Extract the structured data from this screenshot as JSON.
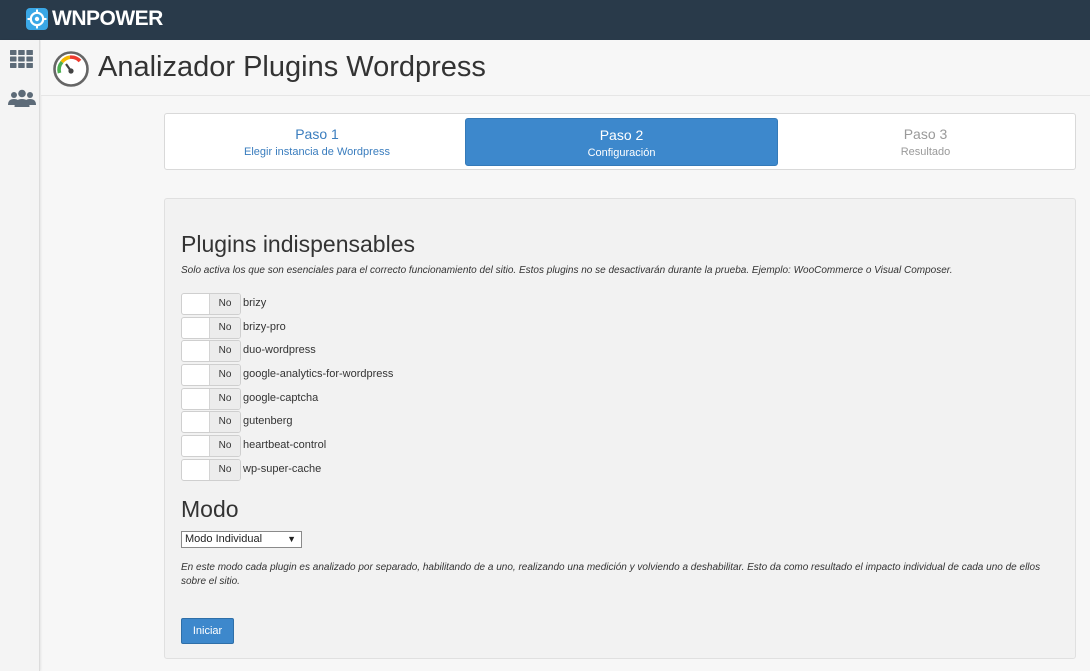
{
  "topbar": {
    "brand": "WNPOWER",
    "brand_icon": "wnpower-logo-icon",
    "brand_color": "#3aa7e6",
    "background": "#293a4a"
  },
  "sidebar": {
    "items": [
      {
        "icon": "grid-apps-icon"
      },
      {
        "icon": "users-icon"
      }
    ]
  },
  "header": {
    "title": "Analizador Plugins Wordpress",
    "logo_icon": "speedometer-icon"
  },
  "steps": [
    {
      "title": "Paso 1",
      "subtitle": "Elegir instancia de Wordpress",
      "state": "completed"
    },
    {
      "title": "Paso 2",
      "subtitle": "Configuración",
      "state": "active"
    },
    {
      "title": "Paso 3",
      "subtitle": "Resultado",
      "state": "pending"
    }
  ],
  "plugins_section": {
    "title": "Plugins indispensables",
    "description": "Solo activa los que son esenciales para el correcto funcionamiento del sitio. Estos plugins no se desactivarán durante la prueba. Ejemplo: WooCommerce o Visual Composer.",
    "toggle_off_label": "No",
    "plugins": [
      {
        "name": "brizy"
      },
      {
        "name": "brizy-pro"
      },
      {
        "name": "duo-wordpress"
      },
      {
        "name": "google-analytics-for-wordpress"
      },
      {
        "name": "google-captcha"
      },
      {
        "name": "gutenberg"
      },
      {
        "name": "heartbeat-control"
      },
      {
        "name": "wp-super-cache"
      }
    ]
  },
  "mode_section": {
    "title": "Modo",
    "selected": "Modo Individual",
    "description": "En este modo cada plugin es analizado por separado, habilitando de a uno, realizando una medición y volviendo a deshabilitar. Esto da como resultado el impacto individual de cada uno de ellos sobre el sitio."
  },
  "actions": {
    "start_label": "Iniciar"
  },
  "colors": {
    "accent": "#3d88cc",
    "link": "#3a7dbe",
    "muted": "#9a9a9a"
  }
}
